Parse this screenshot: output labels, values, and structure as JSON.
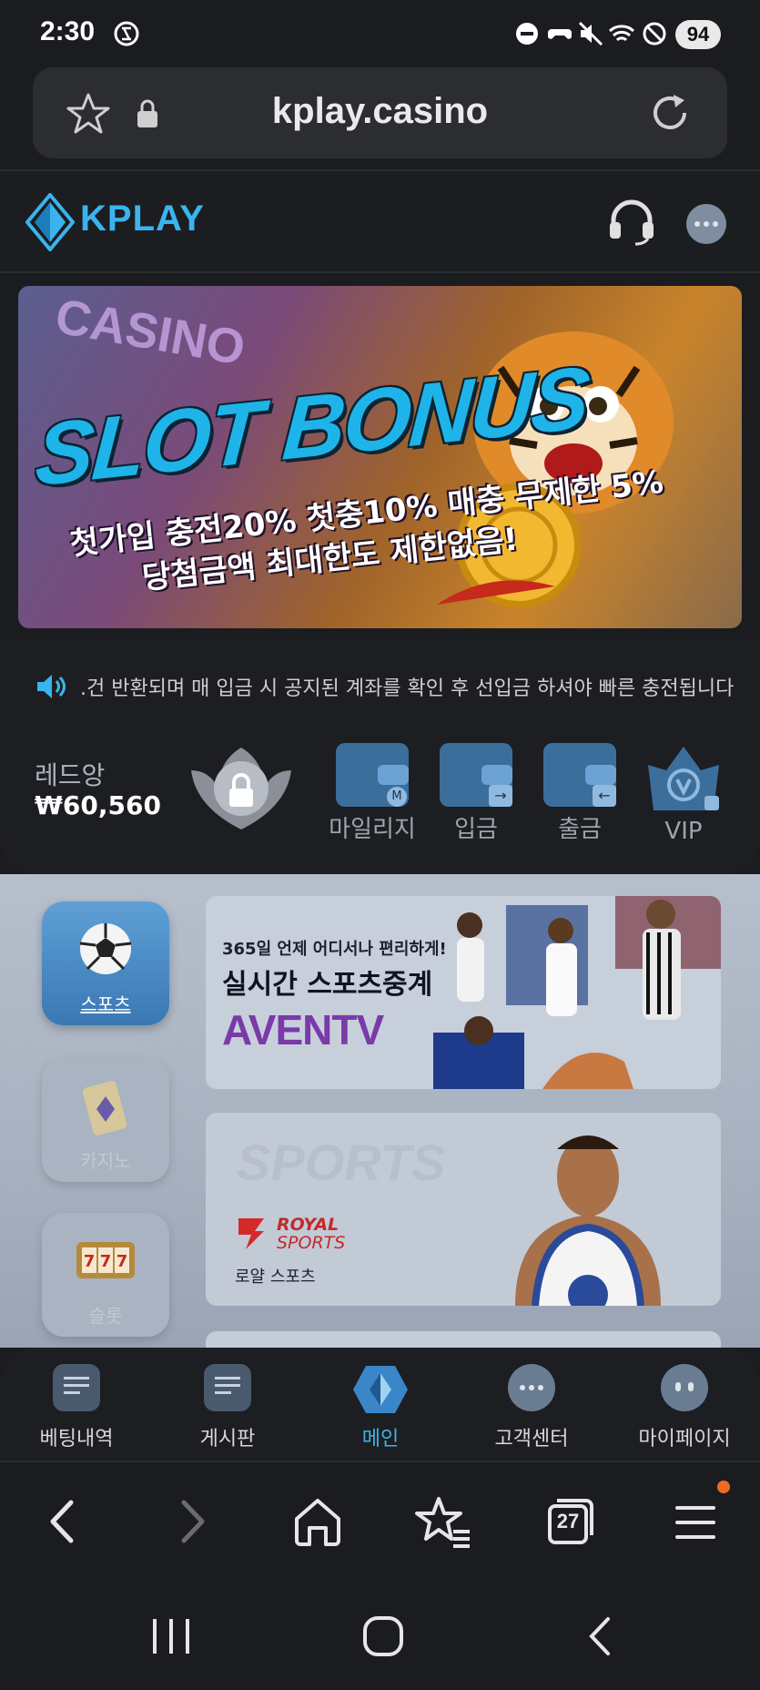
{
  "status_bar": {
    "time": "2:30",
    "battery": "94",
    "icons": [
      "sync-icon",
      "do-not-disturb-icon",
      "game-controller-icon",
      "mute-icon",
      "wifi-icon",
      "block-icon"
    ]
  },
  "browser": {
    "url": "kplay.casino",
    "icons": [
      "star-icon",
      "lock-icon",
      "reload-icon"
    ]
  },
  "site_header": {
    "logo_text": "KPLAY",
    "icons": [
      "headset-icon",
      "chat-icon"
    ]
  },
  "banner": {
    "casino_text": "CASINO",
    "title": "SLOT BONUS",
    "line1": "첫가입 충전20% 첫충10% 매충 무제한 5%",
    "line2": "당첨금액 최대한도 제한없음!"
  },
  "notice": {
    "text": ".건 반환되며 매 입금 시 공지된 계좌를 확인 후 선입금 하셔야 빠른 충전됩니다"
  },
  "user": {
    "name": "레드앙",
    "balance": "₩60,560"
  },
  "quick_actions": [
    {
      "label": "마일리지",
      "icon": "mileage-wallet-icon"
    },
    {
      "label": "입금",
      "icon": "deposit-wallet-icon"
    },
    {
      "label": "출금",
      "icon": "withdraw-wallet-icon"
    },
    {
      "label": "VIP",
      "icon": "vip-crown-icon"
    }
  ],
  "side_menu": [
    {
      "label": "스포츠",
      "icon": "soccer-ball-icon"
    },
    {
      "label": "카지노",
      "icon": "playing-card-icon"
    },
    {
      "label": "슬롯",
      "icon": "slot-machine-icon"
    }
  ],
  "cards": {
    "aven": {
      "subtitle": "365일 언제 어디서나 편리하게!",
      "title": "실시간 스포츠중계",
      "brand": "AVENTV"
    },
    "royal": {
      "bg_text": "SPORTS",
      "brand_line1": "ROYAL",
      "brand_line2": "SPORTS",
      "caption": "로얄 스포츠"
    }
  },
  "bottom_nav": [
    {
      "label": "베팅내역",
      "icon": "betting-history-icon"
    },
    {
      "label": "게시판",
      "icon": "board-icon"
    },
    {
      "label": "메인",
      "icon": "home-logo-icon"
    },
    {
      "label": "고객센터",
      "icon": "customer-center-icon"
    },
    {
      "label": "마이페이지",
      "icon": "my-page-icon"
    }
  ],
  "browser_toolbar": {
    "tabs_count": "27",
    "icons": [
      "back-icon",
      "forward-icon",
      "home-icon",
      "bookmarks-icon",
      "tabs-icon",
      "menu-icon"
    ]
  },
  "colors": {
    "accent": "#3ab4ee",
    "background": "#1b1c20",
    "panel": "#1d1e22",
    "notification_dot": "#f26a21"
  }
}
